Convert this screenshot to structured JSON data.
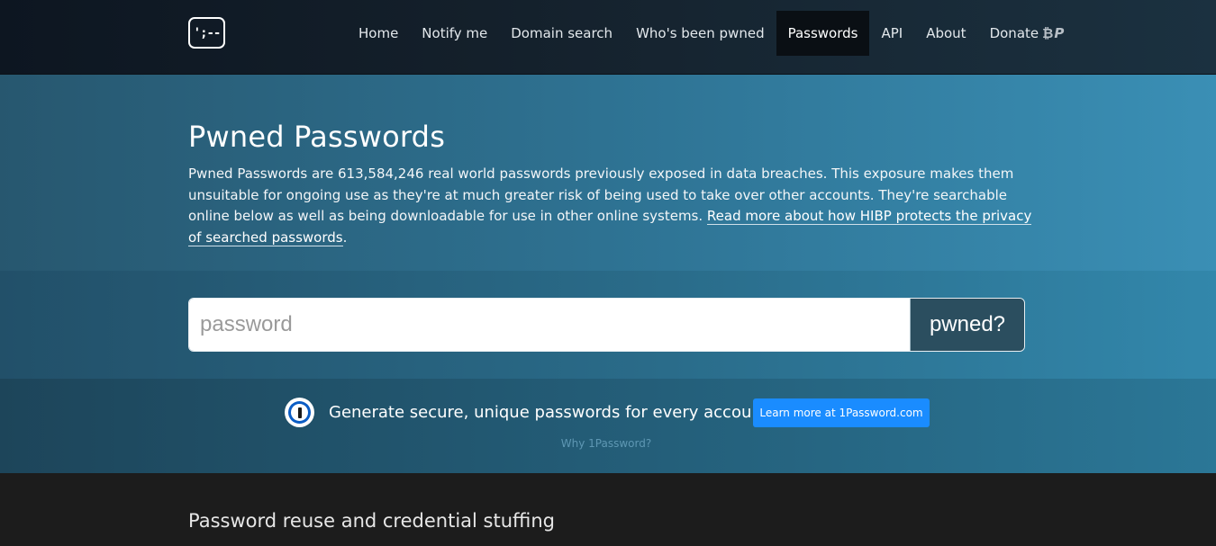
{
  "nav": {
    "logo_text": "';--",
    "items": [
      {
        "label": "Home"
      },
      {
        "label": "Notify me"
      },
      {
        "label": "Domain search"
      },
      {
        "label": "Who's been pwned"
      },
      {
        "label": "Passwords"
      },
      {
        "label": "API"
      },
      {
        "label": "About"
      },
      {
        "label": "Donate"
      }
    ],
    "active": "Passwords",
    "donate_icons": [
      "bitcoin-icon",
      "paypal-icon"
    ]
  },
  "hero": {
    "title": "Pwned Passwords",
    "description": "Pwned Passwords are 613,584,246 real world passwords previously exposed in data breaches. This exposure makes them unsuitable for ongoing use as they're at much greater risk of being used to take over other accounts. They're searchable online below as well as being downloadable for use in other online systems. ",
    "link_text": "Read more about how HIBP protects the privacy of searched passwords",
    "link_suffix": "."
  },
  "search": {
    "placeholder": "password",
    "value": "",
    "button_label": "pwned?"
  },
  "promo": {
    "icon": "1password-icon",
    "text": "Generate secure, unique passwords for every account",
    "button_label": "Learn more at 1Password.com",
    "link_text": "Why 1Password?"
  },
  "section": {
    "heading": "Password reuse and credential stuffing"
  },
  "colors": {
    "accent_button": "#1a8cff",
    "search_button": "#2b4e5f",
    "active_nav": "#0a0f14"
  }
}
